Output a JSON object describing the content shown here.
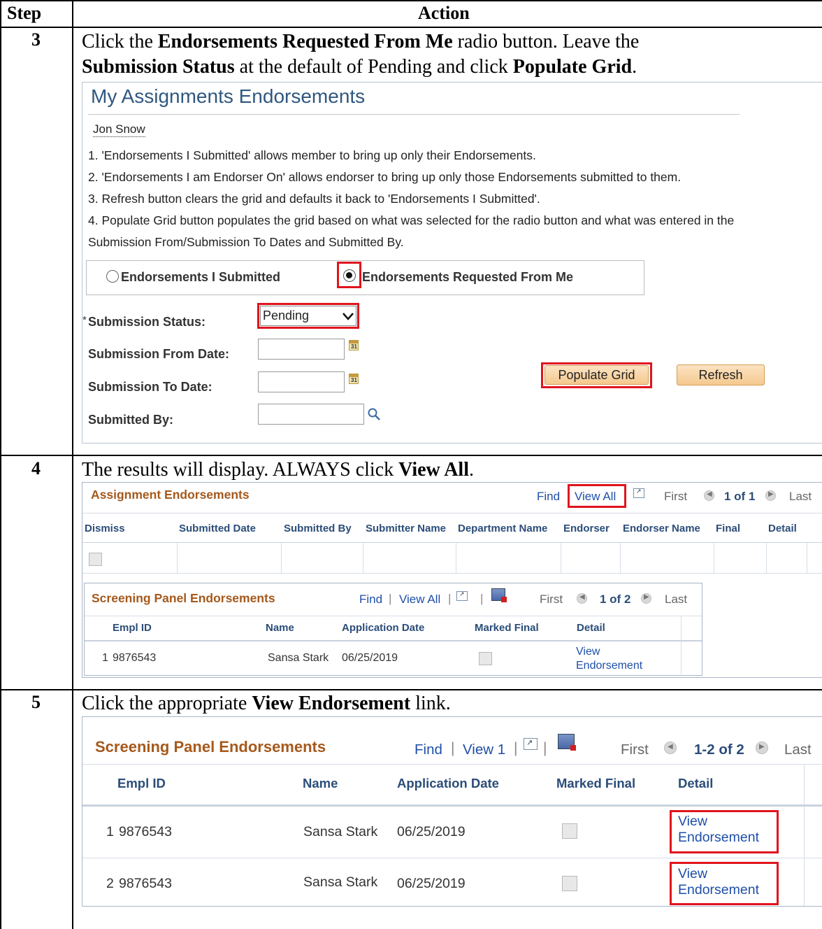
{
  "table": {
    "col_step": "Step",
    "col_action": "Action"
  },
  "step3": {
    "num": "3",
    "line1_a": "Click the ",
    "line1_b": "Endorsements Requested From Me",
    "line1_c": " radio button. Leave the",
    "line2_a": "Submission Status",
    "line2_b": " at the default of Pending and click ",
    "line2_c": "Populate Grid",
    "line2_d": ".",
    "screen": {
      "title": "My Assignments Endorsements",
      "user": "Jon Snow",
      "notes": [
        "1. 'Endorsements I Submitted' allows member to bring up only their Endorsements.",
        "2. 'Endorsements I am Endorser On' allows endorser to bring up only those Endorsements submitted to them.",
        "3. Refresh button clears the grid and defaults it back to 'Endorsements I Submitted'.",
        "4. Populate Grid button populates the grid based on what was selected for the radio button and what was entered in the",
        "Submission From/Submission To Dates and Submitted By."
      ],
      "radio_1": "Endorsements I Submitted",
      "radio_2": "Endorsements Requested From Me",
      "status_req": "*",
      "status_label": "Submission Status:",
      "status_value": "Pending",
      "from_label": "Submission From Date:",
      "to_label": "Submission To Date:",
      "by_label": "Submitted By:",
      "populate_label": "Populate Grid",
      "refresh_label": "Refresh",
      "cal_glyph": "31"
    }
  },
  "step4": {
    "num": "4",
    "text_a": "The results will display. ALWAYS click ",
    "text_b": "View All",
    "text_c": ".",
    "grid1": {
      "title": "Assignment Endorsements",
      "find": "Find",
      "view_all": "View All",
      "first": "First",
      "count": "1 of 1",
      "last": "Last",
      "headers": [
        "Dismiss",
        "Submitted Date",
        "Submitted By",
        "Submitter Name",
        "Department Name",
        "Endorser",
        "Endorser Name",
        "Final",
        "Detail"
      ]
    },
    "grid2": {
      "title": "Screening Panel Endorsements",
      "find": "Find",
      "sep": "|",
      "view_all": "View All",
      "first": "First",
      "count": "1 of 2",
      "last": "Last",
      "headers": [
        "Empl ID",
        "Name",
        "Application Date",
        "Marked Final",
        "Detail"
      ],
      "row": {
        "num": "1",
        "empl_id": "9876543",
        "name": "Sansa Stark",
        "date": "06/25/2019",
        "link_1": "View",
        "link_2": "Endorsement"
      }
    }
  },
  "step5": {
    "num": "5",
    "text_a": "Click the appropriate ",
    "text_b": "View Endorsement",
    "text_c": " link.",
    "grid": {
      "title": "Screening Panel Endorsements",
      "find": "Find",
      "sep": "|",
      "view_1": "View 1",
      "first": "First",
      "count": "1-2 of 2",
      "last": "Last",
      "headers": [
        "Empl ID",
        "Name",
        "Application Date",
        "Marked Final",
        "Detail"
      ],
      "rows": [
        {
          "num": "1",
          "empl_id": "9876543",
          "name": "Sansa Stark",
          "date": "06/25/2019",
          "link_1": "View",
          "link_2": "Endorsement"
        },
        {
          "num": "2",
          "empl_id": "9876543",
          "name": "Sansa Stark",
          "date": "06/25/2019",
          "link_1": "View",
          "link_2": "Endorsement"
        }
      ]
    }
  },
  "colors": {
    "highlight_red": "#e0141e",
    "ps_title_blue": "#2f5780",
    "grid_title_orange": "#a5591c",
    "link_blue": "#1f4fa8",
    "button_fill": "#f5c98e"
  }
}
